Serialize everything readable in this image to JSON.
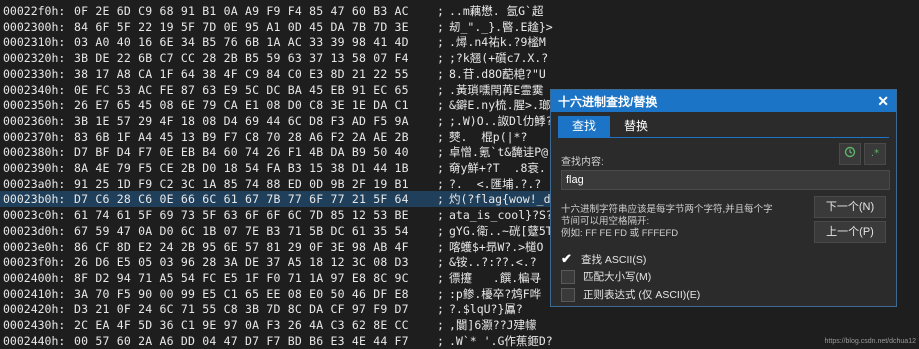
{
  "hex_rows": [
    {
      "addr": "00022f0h:",
      "bytes": "0F 2E 6D C9 68 91 B1 0A A9 F9 F4 85 47 60 B3 AC",
      "sep": ";",
      "ascii": "..m藕懋. 氬G`超"
    },
    {
      "addr": "0002300h:",
      "bytes": "84 6F 5F 22 19 5F 7D 0E 95 A1 0D 45 DA 7B 7D 3E",
      "sep": ";",
      "ascii": "刼_\"._}.暋.E趛}>"
    },
    {
      "addr": "0002310h:",
      "bytes": "03 A0 40 16 6E 34 B5 76 6B 1A AC 33 39 98 41 4D",
      "sep": ";",
      "ascii": ".燖.n4祐k.?9榓M"
    },
    {
      "addr": "0002320h:",
      "bytes": "3B DE 22 6B C7 CC 28 2B B5 59 63 37 13 58 07 F4",
      "sep": ";",
      "ascii": ";?k翘(+礩c7.X.?"
    },
    {
      "addr": "0002330h:",
      "bytes": "38 17 A8 CA 1F 64 38 4F C9 84 C0 E3 8D 21 22 55",
      "sep": ";",
      "ascii": "8.苷.d8O蓜梍?\"U"
    },
    {
      "addr": "0002340h:",
      "bytes": "0E FC 53 AC FE 87 63 E9 5C DC BA 45 EB 91 EC 65",
      "sep": ";",
      "ascii": ".黃瑣嚑閇苒E霊霙"
    },
    {
      "addr": "0002350h:",
      "bytes": "26 E7 65 45 08 6E 79 CA E1 08 D0 C8 3E 1E DA C1",
      "sep": ";",
      "ascii": "&鐴E.ny梳.腥>.瑯"
    },
    {
      "addr": "0002360h:",
      "bytes": "3B 1E 57 29 4F 18 08 D4 69 44 6C D8 F3 AD F5 9A",
      "sep": ";",
      "ascii": ";.W)O..詉Dl仂鯚?"
    },
    {
      "addr": "0002370h:",
      "bytes": "83 6B 1F A4 45 13 B9 F7 C8 70 28 A6 F2 2A AE 2B",
      "sep": ";",
      "ascii": "僰.  棍p(|*?"
    },
    {
      "addr": "0002380h:",
      "bytes": "D7 BF D4 F7 0E EB B4 60 74 26 F1 4B DA B9 50 40",
      "sep": ";",
      "ascii": "卓憎.氪`t&馣诖P@"
    },
    {
      "addr": "0002390h:",
      "bytes": "8A 4E 79 F5 CE 2B D0 18 54 FA B3 15 38 D1 44 1B",
      "sep": ";",
      "ascii": "奛y鮮+?T  .8衰."
    },
    {
      "addr": "00023a0h:",
      "bytes": "91 25 1D F9 C2 3C 1A 85 74 88 ED 0D 9B 2F 19 B1",
      "sep": ";",
      "ascii": "?.  <.匯埔.?.?"
    },
    {
      "addr": "00023b0h:",
      "bytes": "D7 C6 28 C6 0E 66 6C 61 67 7B 77 6F 77 21 5F 64",
      "sep": ";",
      "ascii": "灼(?flag{wow!_d",
      "highlight": true
    },
    {
      "addr": "00023c0h:",
      "bytes": "61 74 61 5F 69 73 5F 63 6F 6F 6C 7D 85 12 53 BE",
      "sep": ";",
      "ascii": "ata_is_cool}?S?"
    },
    {
      "addr": "00023d0h:",
      "bytes": "67 59 47 0A D0 6C 1B 07 7E B3 71 5B DC 61 35 54",
      "sep": ";",
      "ascii": "gYG.衛..~硄[躠5T"
    },
    {
      "addr": "00023e0h:",
      "bytes": "86 CF 8D E2 24 2B 95 6E 57 81 29 0F 3E 98 AB 4F",
      "sep": ";",
      "ascii": "喀蠖$+昻W?.>檤O"
    },
    {
      "addr": "00023f0h:",
      "bytes": "26 D6 E5 05 03 96 28 3A DE 37 A5 18 12 3C 08 D3",
      "sep": ";",
      "ascii": "&铵..?:??.<.?"
    },
    {
      "addr": "0002400h:",
      "bytes": "8F D2 94 71 A5 54 FC E5 1F F0 71 1A 97 E8 8C 9C",
      "sep": ";",
      "ascii": "徱攓   .饌.楄寻"
    },
    {
      "addr": "0002410h:",
      "bytes": "3A 70 F5 90 00 99 E5 C1 65 EE 08 E0 50 46 DF E8",
      "sep": ";",
      "ascii": ":p鲹.櫌卒?鸩F哗"
    },
    {
      "addr": "0002420h:",
      "bytes": "D3 21 0F 24 6C 71 55 C8 3B 7D 8C DA CF 97 F9 D7",
      "sep": ";",
      "ascii": "?.$lqU?}屭?"
    },
    {
      "addr": "0002430h:",
      "bytes": "2C EA 4F 5D 36 C1 9E 97 0A F3 26 4A C3 62 8E CC",
      "sep": ";",
      "ascii": ",闤]6灏??J肂幪"
    },
    {
      "addr": "0002440h:",
      "bytes": "00 57 60 2A A6 DD 04 47 D7 F7 BD B6 E3 4E 44 F7",
      "sep": ";",
      "ascii": ".W`* '.G作蕉鉔D?"
    }
  ],
  "dialog": {
    "title": "十六进制查找/替换",
    "close": "✕",
    "tabs": [
      "查找",
      "替换"
    ],
    "search_label": "查找内容:",
    "search_value": "flag",
    "hint_line1": "十六进制字符串应该是每字节两个字符,并且每个字",
    "hint_line2": "节间可以用空格隔开:",
    "hint_line3": "例如: FF FE FD 或 FFFEFD",
    "btn_next": "下一个(N)",
    "btn_prev": "上一个(P)",
    "opt_ascii": "查找 ASCII(S)",
    "opt_case": "匹配大小写(M)",
    "opt_regex": "正则表达式 (仅 ASCII)(E)",
    "history_icon": "history-icon",
    "regex_icon": "regex-icon"
  },
  "watermark": "https://blog.csdn.net/dchua12",
  "colors": {
    "accent": "#1b74c5",
    "highlight": "#2c6d9c",
    "background": "#1e1e1e"
  }
}
